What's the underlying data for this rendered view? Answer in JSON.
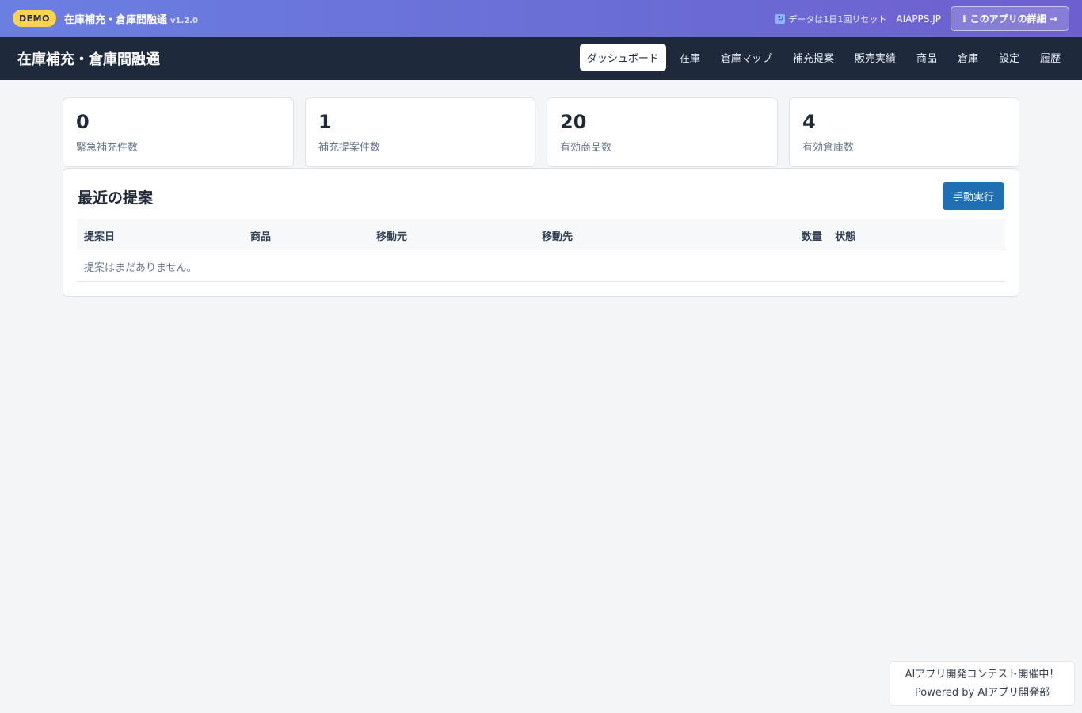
{
  "demo_bar": {
    "badge": "DEMO",
    "title": "在庫補充・倉庫間融通",
    "version": "v1.2.0",
    "reset_note": "データは1日1回リセット",
    "site": "AIAPPS.JP",
    "detail_button": "このアプリの詳細 →",
    "info_icon": "ℹ"
  },
  "navbar": {
    "title": "在庫補充・倉庫間融通",
    "items": [
      {
        "label": "ダッシュボード",
        "active": true
      },
      {
        "label": "在庫"
      },
      {
        "label": "倉庫マップ"
      },
      {
        "label": "補充提案"
      },
      {
        "label": "販売実績"
      },
      {
        "label": "商品"
      },
      {
        "label": "倉庫"
      },
      {
        "label": "設定"
      },
      {
        "label": "履歴"
      }
    ]
  },
  "stats": [
    {
      "value": "0",
      "label": "緊急補充件数"
    },
    {
      "value": "1",
      "label": "補充提案件数"
    },
    {
      "value": "20",
      "label": "有効商品数"
    },
    {
      "value": "4",
      "label": "有効倉庫数"
    }
  ],
  "recent": {
    "title": "最近の提案",
    "run_button": "手動実行",
    "columns": [
      "提案日",
      "商品",
      "移動元",
      "移動先",
      "数量",
      "状態"
    ],
    "empty_message": "提案はまだありません。"
  },
  "footer": {
    "line1": "AIアプリ開発コンテスト開催中！",
    "line2": "Powered by AIアプリ開発部"
  },
  "colors": {
    "accent": "#1f6fb2",
    "nav_bg": "#1e293b",
    "badge": "#fcd34d"
  }
}
